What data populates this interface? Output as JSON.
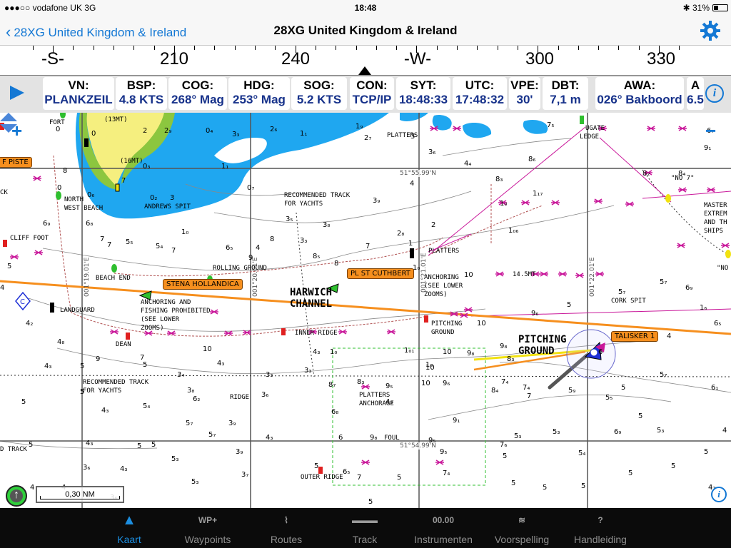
{
  "status": {
    "carrier": "●●●○○ vodafone UK  3G",
    "time": "18:48",
    "battery": "31%",
    "battery_level": 0.31
  },
  "nav": {
    "back_label": "28XG United Kingdom & Ireland",
    "title": "28XG United Kingdom & Ireland"
  },
  "compass": {
    "labels": [
      {
        "text": "-S-"
      },
      {
        "text": "210"
      },
      {
        "text": "240"
      },
      {
        "text": "-W-"
      },
      {
        "text": "300"
      },
      {
        "text": "330"
      }
    ]
  },
  "instruments": [
    {
      "key": "VN:",
      "value": "PLANKZEIL"
    },
    {
      "key": "BSP:",
      "value": "4.8 KTS"
    },
    {
      "key": "COG:",
      "value": "268° Mag"
    },
    {
      "key": "HDG:",
      "value": "253° Mag"
    },
    {
      "key": "SOG:",
      "value": "5.2 KTS"
    },
    {
      "key": "CON:",
      "value": "TCP/IP"
    },
    {
      "key": "SYT:",
      "value": "18:48:33"
    },
    {
      "key": "UTC:",
      "value": "17:48:32"
    },
    {
      "key": "VPE:",
      "value": "30'"
    },
    {
      "key": "DBT:",
      "value": "7,1 m"
    },
    {
      "key": "AWA:",
      "value": "026° Bakboord"
    },
    {
      "key": "A",
      "value": "6.5"
    }
  ],
  "chart": {
    "tags": {
      "stena": "STENA HOLLANDICA",
      "cuthbert": "PL ST CUTHBERT",
      "talisker": "TALISKER 1",
      "piste": "F PISTE"
    },
    "big_labels": {
      "harwich": "HARWICH\nCHANNEL",
      "pitching": "PITCHING\nGROUND"
    },
    "labels": {
      "fort": "FORT",
      "north_west_beach": "NORTH\nWEST BEACH",
      "andrews_spit": "ANDREWS SPIT",
      "cliff_foot": "CLIFF FOOT",
      "beach_end": "BEACH END",
      "landguard": "LANDGUARD",
      "anchoring_fishing": "ANCHORING AND\nFISHING PROHIBITED\n(SEE LOWER\nZOOMS)",
      "rolling_ground": "ROLLING GROUND",
      "rec_track_1": "RECOMMENDED TRACK\nFOR YACHTS",
      "rec_track_2": "RECOMMENDED TRACK\nFOR YACHTS",
      "platters_1": "PLATTERS",
      "platters_2": "PLATTERS",
      "anchoring_2": "ANCHORING\n(SEE LOWER\nZOOMS)",
      "pitching_small": "PITCHING\nGROUND",
      "inner_ridge": "INNER RIDGE",
      "deane": "DEAN",
      "ridge": "RIDGE",
      "platters_anchorage": "PLATTERS\nANCHORAGE",
      "foul": "FOUL",
      "outer_ridge": "OUTER RIDGE",
      "cork_spit": "CORK SPIT",
      "no7": "\"NO 7\"",
      "ledge": "LEDGE",
      "cutler": "UGATE",
      "master": "MASTER\nEXTREM\nAND TH\nSHIPS",
      "no_right": "\"NO",
      "d_track": "D TRACK",
      "ck": "CK",
      "13mt": "(13MT)",
      "16mt": "(16MT)",
      "14_5mt": "14.5MT"
    },
    "coords": {
      "lat1": "51°55.99'N",
      "lat2": "51°54.99'N",
      "lon1": "001°19.01'E",
      "lon2": "001°20.01'E",
      "lon3": "001°21.01'E",
      "lon4": "001°22.01'E"
    },
    "scale": "0,30 NM"
  },
  "tabs": [
    {
      "icon": "▲",
      "label": "Kaart",
      "active": true
    },
    {
      "icon": "WP+",
      "label": "Waypoints"
    },
    {
      "icon": "⌇",
      "label": "Routes"
    },
    {
      "icon": "▬▬▬",
      "label": "Track"
    },
    {
      "icon": "00.00",
      "label": "Instrumenten"
    },
    {
      "icon": "≋",
      "label": "Voorspelling"
    },
    {
      "icon": "?",
      "label": "Handleiding"
    }
  ],
  "colors": {
    "accent": "#1478d4",
    "water": "#1fa7f0",
    "land": "#f5ef7f",
    "drying": "#8cc63f",
    "course": "#f68f1e",
    "magenta": "#c9189a"
  }
}
